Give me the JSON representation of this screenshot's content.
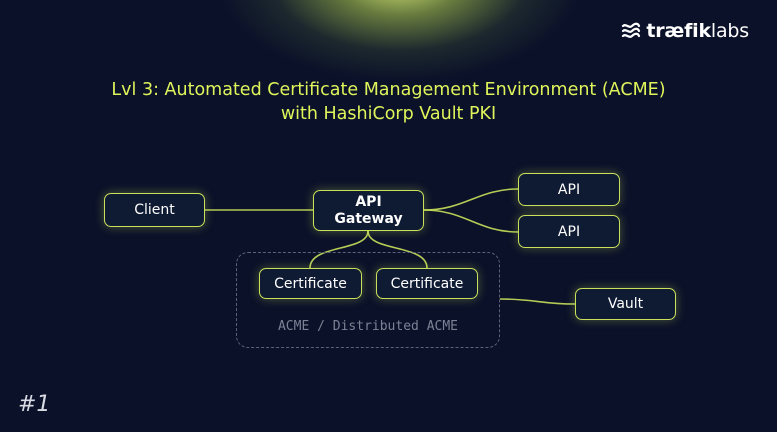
{
  "brand": {
    "name_bold": "træfik",
    "name_light": "labs",
    "icon": "traefik-wave-icon"
  },
  "title": {
    "line1": "Lvl 3: Automated Certificate Management Environment (ACME)",
    "line2": "with HashiCorp Vault PKI"
  },
  "nodes": {
    "client": "Client",
    "gateway_line1": "API",
    "gateway_line2": "Gateway",
    "api_top": "API",
    "api_bottom": "API",
    "cert_left": "Certificate",
    "cert_right": "Certificate",
    "vault": "Vault"
  },
  "group_label": "ACME / Distributed ACME",
  "slide_number": "#1",
  "colors": {
    "background": "#0b1129",
    "accent": "#c8e05a",
    "title": "#dff45a",
    "dashed_group": "#5c6378"
  }
}
